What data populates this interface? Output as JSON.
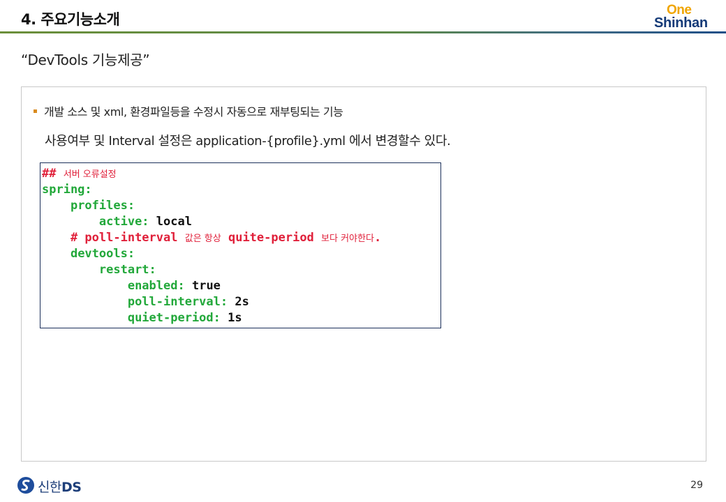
{
  "header": {
    "section_title": "4. 주요기능소개",
    "logo_one": "One",
    "logo_shinhan": "Shinhan"
  },
  "slide": {
    "subtitle": "“DevTools 기능제공”",
    "bullet": "개발 소스 및 xml, 환경파일등을 수정시 자동으로 재부팅되는 기능",
    "info": "사용여부 및 Interval 설정은 application-{profile}.yml 에서 변경할수 있다."
  },
  "code": {
    "comment1_hash": "##",
    "comment1_text": "서버 오류설정",
    "spring": "spring:",
    "profiles": "profiles:",
    "active_key": "active:",
    "active_val": "local",
    "comment2_a": "# poll-interval",
    "comment2_b": "값은 항상",
    "comment2_c": "quite-period",
    "comment2_d": "보다 커야한다",
    "comment2_e": ".",
    "devtools": "devtools:",
    "restart": "restart:",
    "enabled_key": "enabled:",
    "enabled_val": "true",
    "poll_key": "poll-interval:",
    "poll_val": "2s",
    "quiet_key": "quiet-period:",
    "quiet_val": "1s"
  },
  "footer": {
    "brand_kr": "신한",
    "brand_ds": "DS",
    "page_number": "29"
  },
  "colors": {
    "accent_orange": "#d98b1e",
    "logo_gold": "#f0a500",
    "brand_navy": "#143a78",
    "code_key_green": "#22a83a",
    "code_comment_red": "#e0203a"
  }
}
